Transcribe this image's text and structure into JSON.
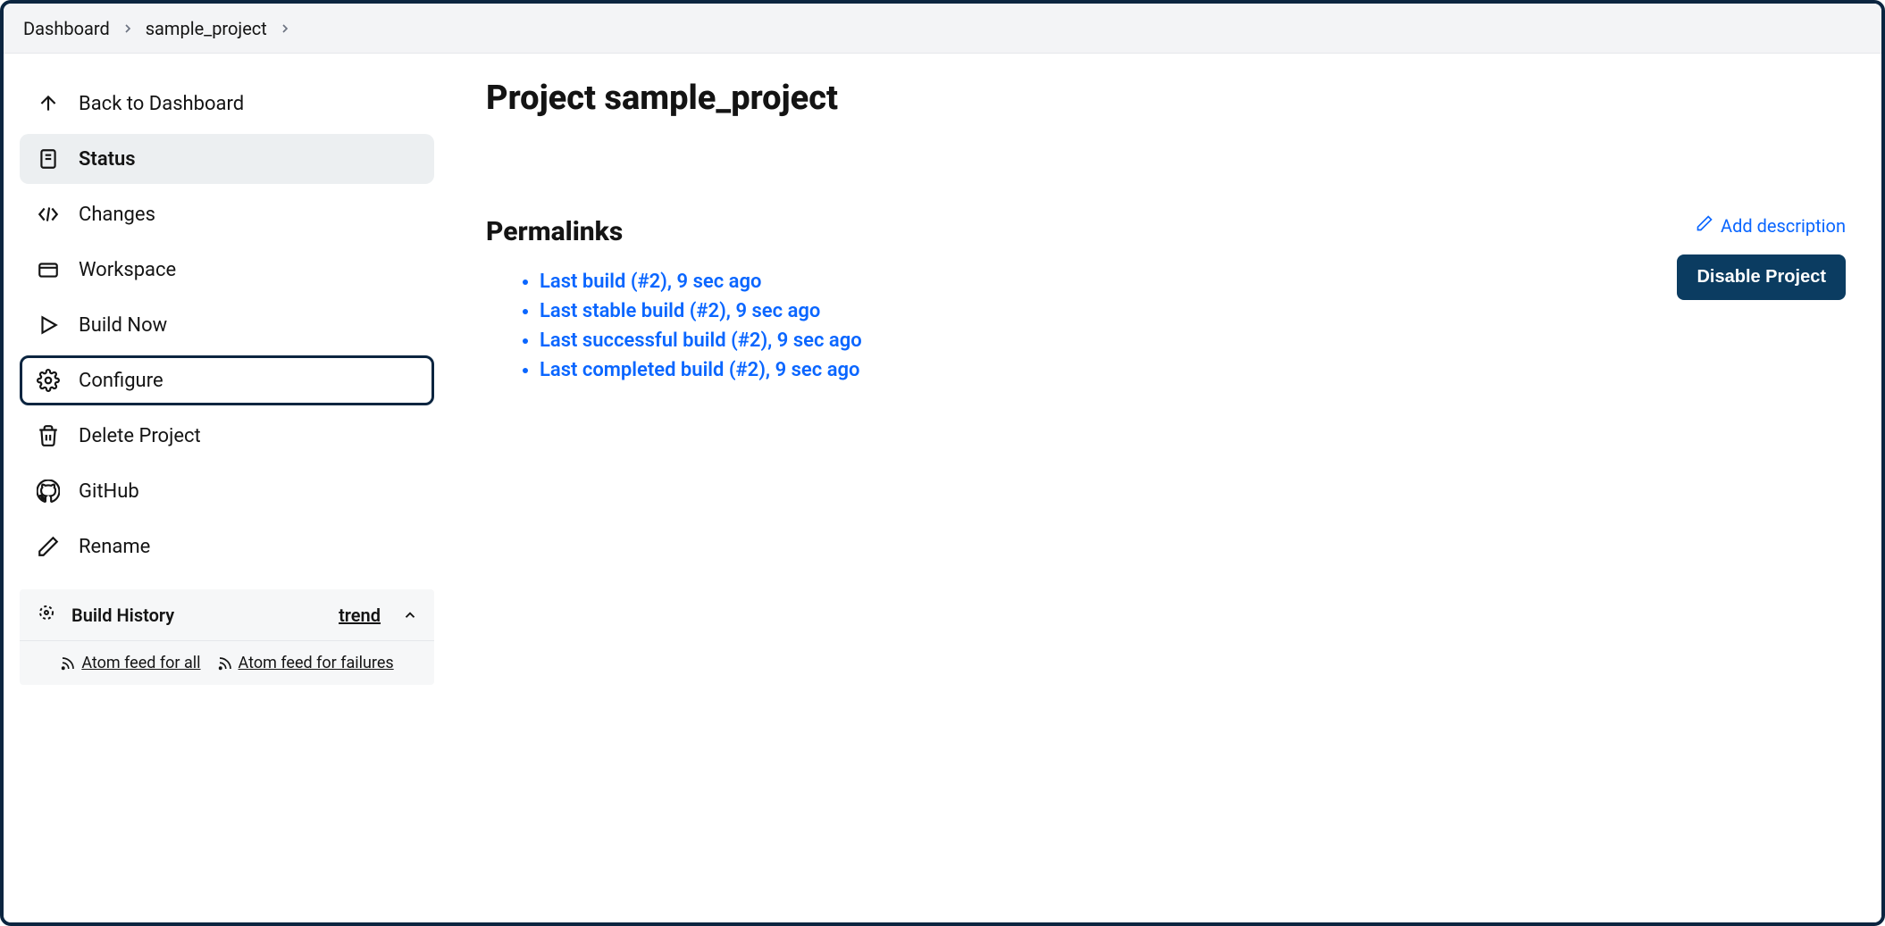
{
  "breadcrumb": {
    "items": [
      "Dashboard",
      "sample_project"
    ]
  },
  "sidebar": {
    "items": [
      {
        "label": "Back to Dashboard"
      },
      {
        "label": "Status"
      },
      {
        "label": "Changes"
      },
      {
        "label": "Workspace"
      },
      {
        "label": "Build Now"
      },
      {
        "label": "Configure"
      },
      {
        "label": "Delete Project"
      },
      {
        "label": "GitHub"
      },
      {
        "label": "Rename"
      }
    ]
  },
  "build_history": {
    "title": "Build History",
    "trend_label": "trend",
    "feeds": {
      "all": "Atom feed for all",
      "failures": "Atom feed for failures"
    }
  },
  "main": {
    "title": "Project sample_project",
    "add_description": "Add description",
    "disable_button": "Disable Project",
    "permalinks_heading": "Permalinks",
    "permalinks": [
      "Last build (#2), 9 sec ago",
      "Last stable build (#2), 9 sec ago",
      "Last successful build (#2), 9 sec ago",
      "Last completed build (#2), 9 sec ago"
    ]
  }
}
